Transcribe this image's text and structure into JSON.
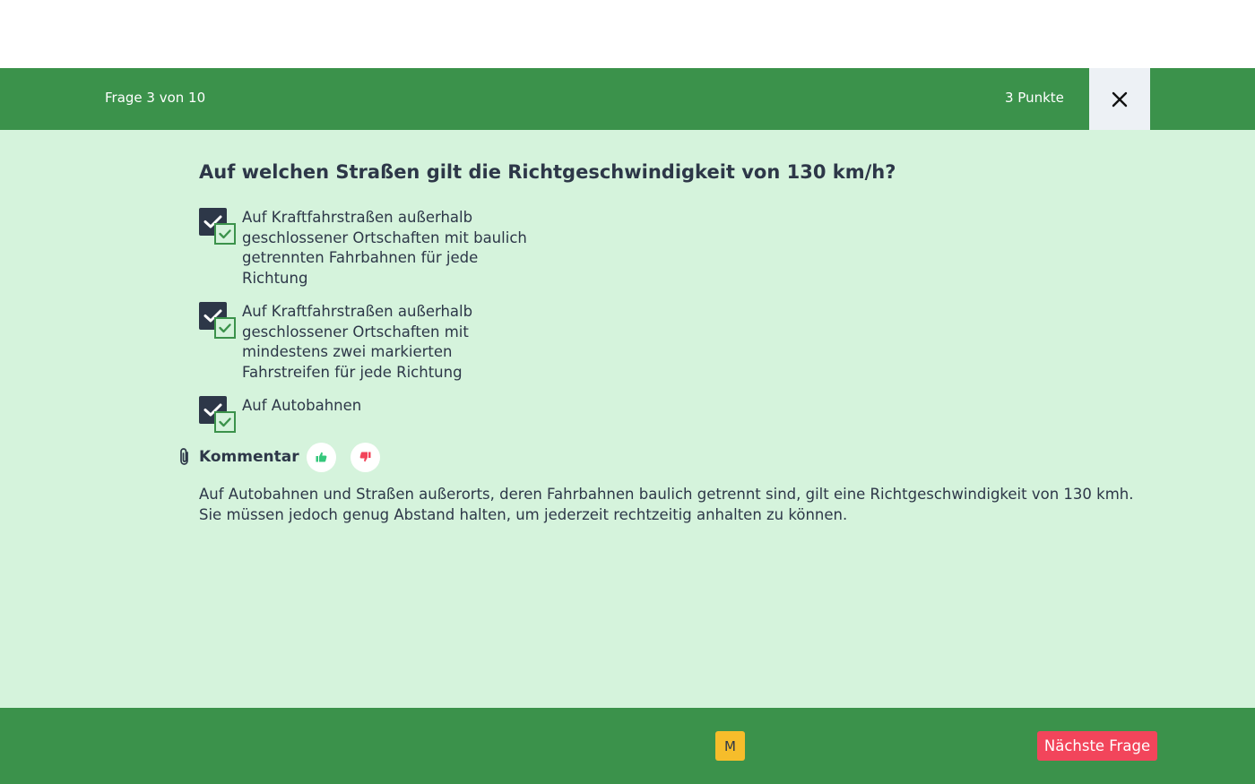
{
  "header": {
    "progress": "Frage 3 von 10",
    "points": "3 Punkte"
  },
  "question": {
    "text": "Auf welchen Straßen gilt die Richtgeschwindigkeit von 130 km/h?"
  },
  "answers": [
    {
      "text": "Auf Kraftfahrstraßen außerhalb geschlossener Ortschaften mit baulich getrennten Fahrbahnen für jede Richtung",
      "selected": true,
      "correct": true
    },
    {
      "text": "Auf Kraftfahrstraßen außerhalb geschlossener Ortschaften mit mindestens zwei markierten Fahrstreifen für jede Richtung",
      "selected": true,
      "correct": true
    },
    {
      "text": "Auf Autobahnen",
      "selected": true,
      "correct": true
    }
  ],
  "comment": {
    "label": "Kommentar",
    "text": "Auf Autobahnen und Straßen außerorts, deren Fahrbahnen baulich getrennt sind, gilt eine Richtgeschwindigkeit von 130 kmh. Sie müssen jedoch genug Abstand halten, um jederzeit rechtzeitig anhalten zu können."
  },
  "footer": {
    "mark_label": "M",
    "next_label": "Nächste Frage"
  },
  "colors": {
    "bar_green": "#3b924b",
    "content_bg": "#d5f3dc",
    "dark": "#2d3748",
    "mark_yellow": "#f6bd2b",
    "next_red": "#f2455b",
    "thumb_up": "#34c77b",
    "thumb_down": "#f2455b"
  }
}
